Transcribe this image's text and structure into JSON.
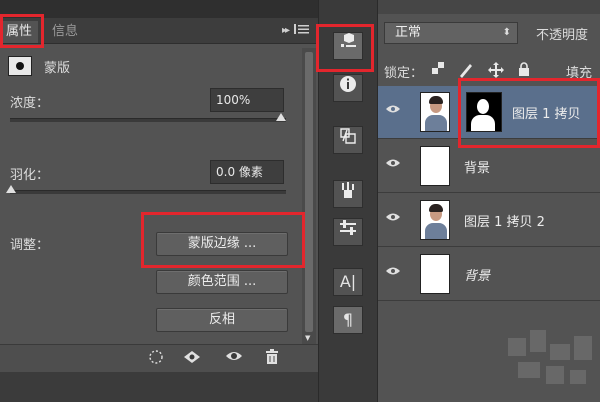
{
  "properties_panel": {
    "tabs": [
      {
        "label": "属性",
        "active": true
      },
      {
        "label": "信息",
        "active": false
      }
    ],
    "collapse_glyph": "▸▸",
    "mask_label": "蒙版",
    "density": {
      "label": "浓度：",
      "value": "100%"
    },
    "feather": {
      "label": "羽化：",
      "value": "0.0 像素"
    },
    "adjust_label": "调整：",
    "buttons": {
      "mask_edge": "蒙版边缘 ...",
      "color_range": "颜色范围 ...",
      "invert": "反相"
    }
  },
  "layers_panel": {
    "blend_mode": "正常",
    "opacity_label": "不透明度",
    "lock_label": "锁定：",
    "fill_label": "填充",
    "layers": [
      {
        "name": "图层 1 拷贝",
        "thumbnail": "photo",
        "has_mask": true,
        "selected": true
      },
      {
        "name": "背景",
        "thumbnail": "white",
        "has_mask": false,
        "selected": false
      },
      {
        "name": "图层 1 拷贝 2",
        "thumbnail": "photo",
        "has_mask": false,
        "selected": false
      },
      {
        "name": "背景",
        "thumbnail": "white",
        "has_mask": false,
        "selected": false
      }
    ]
  },
  "toolbar": {
    "text_tool_glyph": "A|",
    "paragraph_glyph": "¶"
  },
  "colors": {
    "panel_bg": "#535353",
    "selected_layer": "#5a6f8c",
    "highlight": "#e3262d"
  }
}
